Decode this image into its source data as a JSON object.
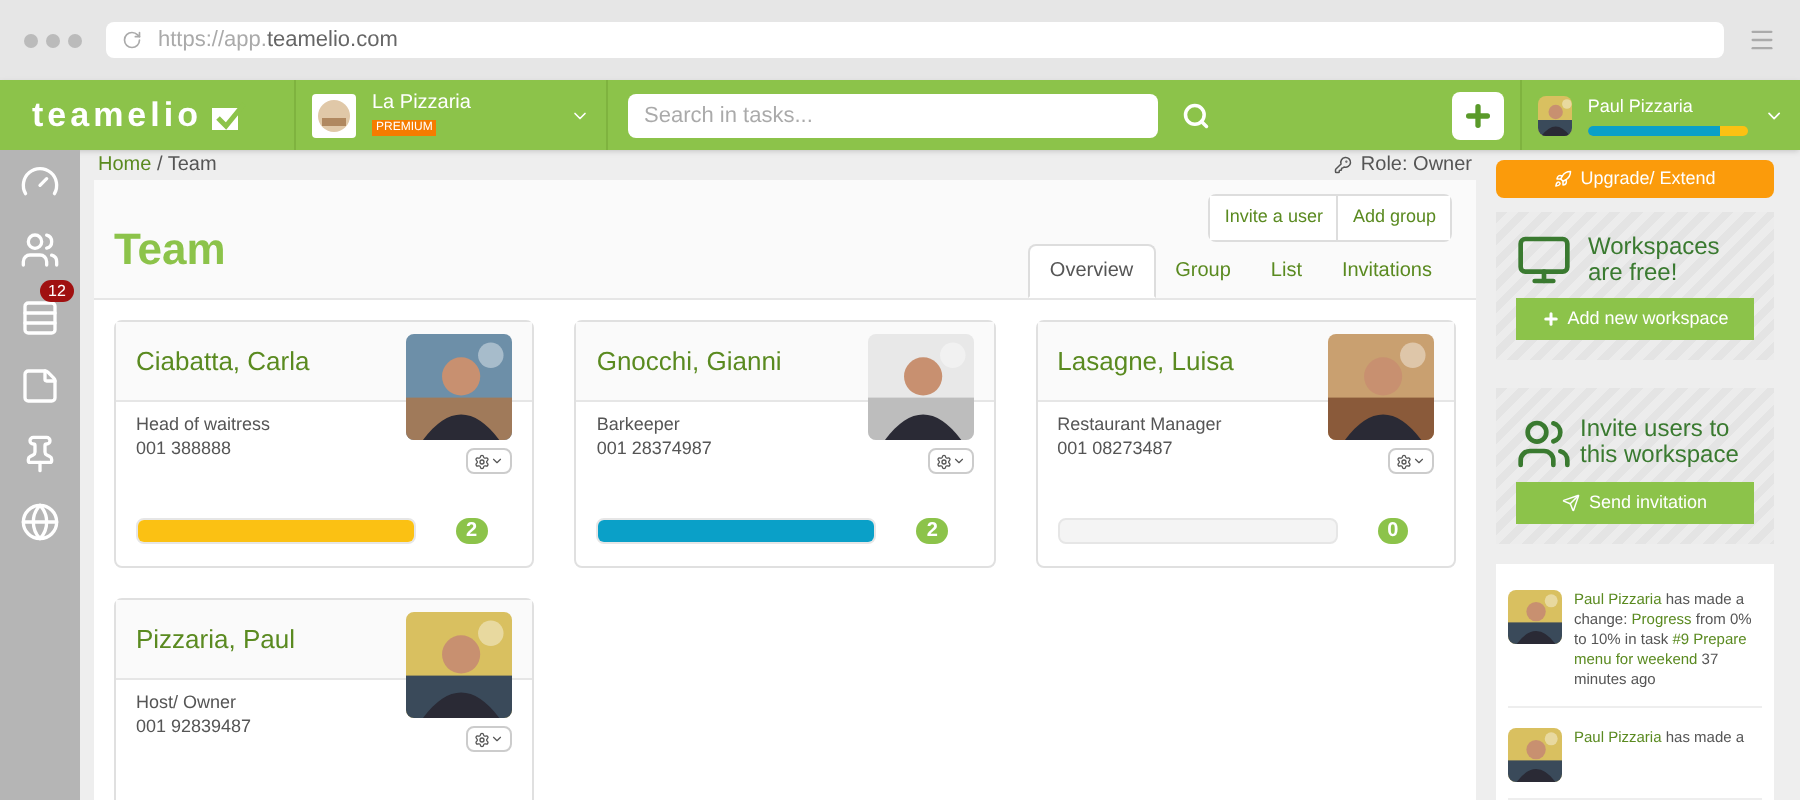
{
  "browser": {
    "url_prefix": "https://app.",
    "url_domain": "teamelio.com"
  },
  "header": {
    "logo": "teamelio",
    "workspace": {
      "name": "La Pizzaria",
      "badge": "PREMIUM"
    },
    "search": {
      "placeholder": "Search in tasks..."
    },
    "user": {
      "name": "Paul Pizzaria",
      "level": 0.83
    }
  },
  "sidebar": {
    "items": [
      {
        "kind": "dashboard"
      },
      {
        "kind": "team"
      },
      {
        "kind": "tasks",
        "badge": "12"
      },
      {
        "kind": "notes"
      },
      {
        "kind": "pin"
      },
      {
        "kind": "globe"
      }
    ]
  },
  "breadcrumb": {
    "home": "Home",
    "separator": "/",
    "current": "Team"
  },
  "role": {
    "label": "Role:",
    "value": "Owner"
  },
  "page": {
    "title": "Team",
    "actions": [
      "Invite a user",
      "Add group"
    ],
    "tabs": [
      {
        "label": "Overview",
        "selected": true
      },
      {
        "label": "Group",
        "selected": false
      },
      {
        "label": "List",
        "selected": false
      },
      {
        "label": "Invitations",
        "selected": false
      }
    ]
  },
  "members": [
    {
      "name": "Ciabatta, Carla",
      "role": "Head of waitress",
      "phone": "001 388888",
      "level": 1,
      "color": "#fbc113",
      "count": "2"
    },
    {
      "name": "Gnocchi, Gianni",
      "role": "Barkeeper",
      "phone": "001 28374987",
      "level": 1,
      "color": "#0aa0c8",
      "count": "2"
    },
    {
      "name": "Lasagne, Luisa",
      "role": "Restaurant Manager",
      "phone": "001 08273487",
      "count": "0"
    },
    {
      "name": "Pizzaria, Paul",
      "role": "Host/ Owner",
      "phone": "001 92839487"
    }
  ],
  "right": {
    "upgrade": "Upgrade/ Extend",
    "workspaces": {
      "title": "Workspaces are free!",
      "button": "Add new workspace"
    },
    "invite": {
      "title": "Invite users to this workspace",
      "button": "Send invitation"
    },
    "feed": [
      {
        "actor": "Paul Pizzaria",
        "action": "has made a change:",
        "field": "Progress",
        "change": "from 0% to 10% in task",
        "task": "#9 Prepare menu for weekend",
        "time": "37 minutes ago"
      },
      {
        "actor": "Paul Pizzaria",
        "action": "has made a"
      }
    ]
  }
}
